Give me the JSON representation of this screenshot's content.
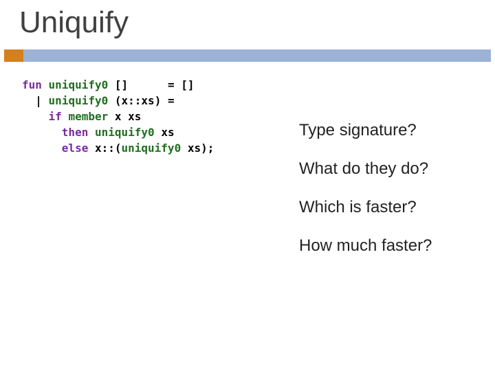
{
  "title": "Uniquify",
  "code": {
    "kw_fun": "fun",
    "fn_name_1": "uniquify0",
    "pat_empty": "[]",
    "eq": "=",
    "res_empty": "[]",
    "pipe": "|",
    "fn_name_2": "uniquify0",
    "pat_cons": "(x::xs)",
    "eq2": "=",
    "kw_if": "if",
    "member": "member",
    "args_member": "x xs",
    "kw_then": "then",
    "fn_name_3": "uniquify0",
    "args_then": "xs",
    "kw_else": "else",
    "cons_head": "x::(",
    "fn_name_4": "uniquify0",
    "cons_tail": " xs);"
  },
  "questions": {
    "q1": "Type signature?",
    "q2": "What do they do?",
    "q3": "Which is faster?",
    "q4": "How much faster?"
  }
}
